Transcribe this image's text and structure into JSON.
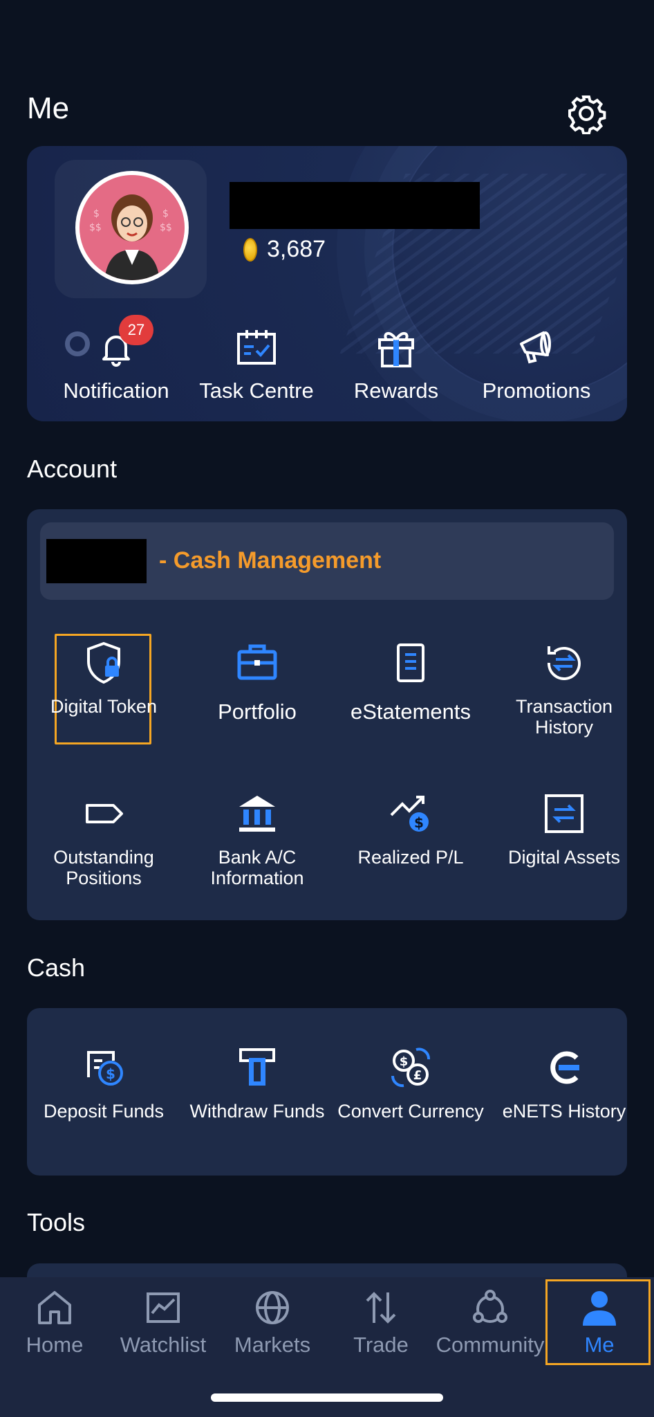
{
  "header": {
    "title": "Me"
  },
  "profile": {
    "points": "3,687",
    "quick_actions": [
      {
        "label": "Notification",
        "icon": "bell-icon",
        "badge": "27"
      },
      {
        "label": "Task Centre",
        "icon": "calendar-check-icon"
      },
      {
        "label": "Rewards",
        "icon": "gift-icon"
      },
      {
        "label": "Promotions",
        "icon": "megaphone-icon"
      }
    ]
  },
  "account": {
    "title": "Account",
    "cash_management_label": "- Cash Management",
    "items": [
      {
        "label": "Digital Token",
        "icon": "shield-lock-icon"
      },
      {
        "label": "Portfolio",
        "icon": "briefcase-icon"
      },
      {
        "label": "eStatements",
        "icon": "document-icon"
      },
      {
        "label": "Transaction History",
        "icon": "history-icon"
      },
      {
        "label": "Outstanding Positions",
        "icon": "tag-icon"
      },
      {
        "label": "Bank A/C Information",
        "icon": "bank-icon"
      },
      {
        "label": "Realized P/L",
        "icon": "trend-dollar-icon"
      },
      {
        "label": "Digital Assets",
        "icon": "digital-assets-icon"
      }
    ]
  },
  "cash": {
    "title": "Cash",
    "items": [
      {
        "label": "Deposit Funds",
        "icon": "deposit-icon"
      },
      {
        "label": "Withdraw Funds",
        "icon": "withdraw-icon"
      },
      {
        "label": "Convert Currency",
        "icon": "currency-convert-icon"
      },
      {
        "label": "eNETS History",
        "icon": "enets-icon"
      }
    ]
  },
  "tools": {
    "title": "Tools"
  },
  "tabbar": {
    "active": "Me",
    "tabs": [
      {
        "label": "Home",
        "icon": "home-icon"
      },
      {
        "label": "Watchlist",
        "icon": "watchlist-icon"
      },
      {
        "label": "Markets",
        "icon": "globe-icon"
      },
      {
        "label": "Trade",
        "icon": "trade-arrows-icon"
      },
      {
        "label": "Community",
        "icon": "community-icon"
      },
      {
        "label": "Me",
        "icon": "person-icon"
      }
    ]
  },
  "colors": {
    "accent_orange": "#f59b2b",
    "active_blue": "#2f86ff",
    "icon_blue": "#2f86ff",
    "background": "#0b1220",
    "panel": "#1e2b48"
  }
}
